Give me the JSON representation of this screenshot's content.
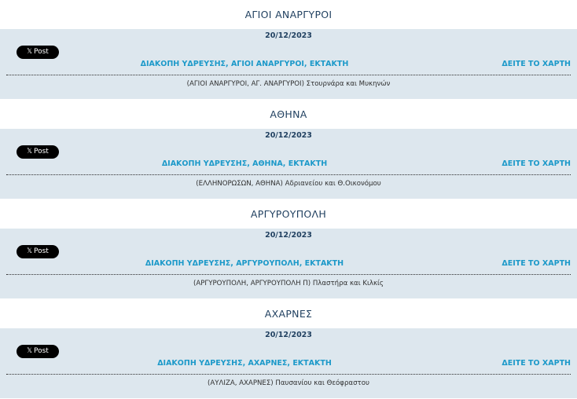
{
  "entries": [
    {
      "area": "ΑΓΙΟΙ ΑΝΑΡΓΥΡΟΙ",
      "date": "20/12/2023",
      "post_label": "Post",
      "headline": "ΔΙΑΚΟΠΗ ΥΔΡΕΥΣΗΣ, ΑΓΙΟΙ ΑΝΑΡΓΥΡΟΙ, ΕΚΤΑΚΤΗ",
      "map_label": "ΔΕΙΤΕ ΤΟ ΧΑΡΤΗ",
      "detail": "(ΑΓΙΟΙ ΑΝΑΡΓΥΡΟΙ, ΑΓ. ΑΝΑΡΓΥΡΟΙ) Στουρνάρα και Μυκηνών"
    },
    {
      "area": "ΑΘΗΝΑ",
      "date": "20/12/2023",
      "post_label": "Post",
      "headline": "ΔΙΑΚΟΠΗ ΥΔΡΕΥΣΗΣ, ΑΘΗΝΑ, ΕΚΤΑΚΤΗ",
      "map_label": "ΔΕΙΤΕ ΤΟ ΧΑΡΤΗ",
      "detail": "(ΕΛΛΗΝΟΡΩΣΩΝ, ΑΘΗΝΑ) Αδριανείου και Θ.Οικονόμου"
    },
    {
      "area": "ΑΡΓΥΡΟΥΠΟΛΗ",
      "date": "20/12/2023",
      "post_label": "Post",
      "headline": "ΔΙΑΚΟΠΗ ΥΔΡΕΥΣΗΣ, ΑΡΓΥΡΟΥΠΟΛΗ, ΕΚΤΑΚΤΗ",
      "map_label": "ΔΕΙΤΕ ΤΟ ΧΑΡΤΗ",
      "detail": "(ΑΡΓΥΡΟΥΠΟΛΗ, ΑΡΓΥΡΟΥΠΟΛΗ Π) Πλαστήρα και Κιλκίς"
    },
    {
      "area": "ΑΧΑΡΝΕΣ",
      "date": "20/12/2023",
      "post_label": "Post",
      "headline": "ΔΙΑΚΟΠΗ ΥΔΡΕΥΣΗΣ, ΑΧΑΡΝΕΣ, ΕΚΤΑΚΤΗ",
      "map_label": "ΔΕΙΤΕ ΤΟ ΧΑΡΤΗ",
      "detail": "(ΑΥΛΙΖΑ, ΑΧΑΡΝΕΣ) Παυσανίου και Θεόφραστου"
    }
  ],
  "colors": {
    "card_bg": "#dde7ee",
    "title": "#1f3f5f",
    "link": "#1c99c9",
    "post_button": "#000000"
  },
  "icons": {
    "post_icon": "x-logo-icon"
  }
}
